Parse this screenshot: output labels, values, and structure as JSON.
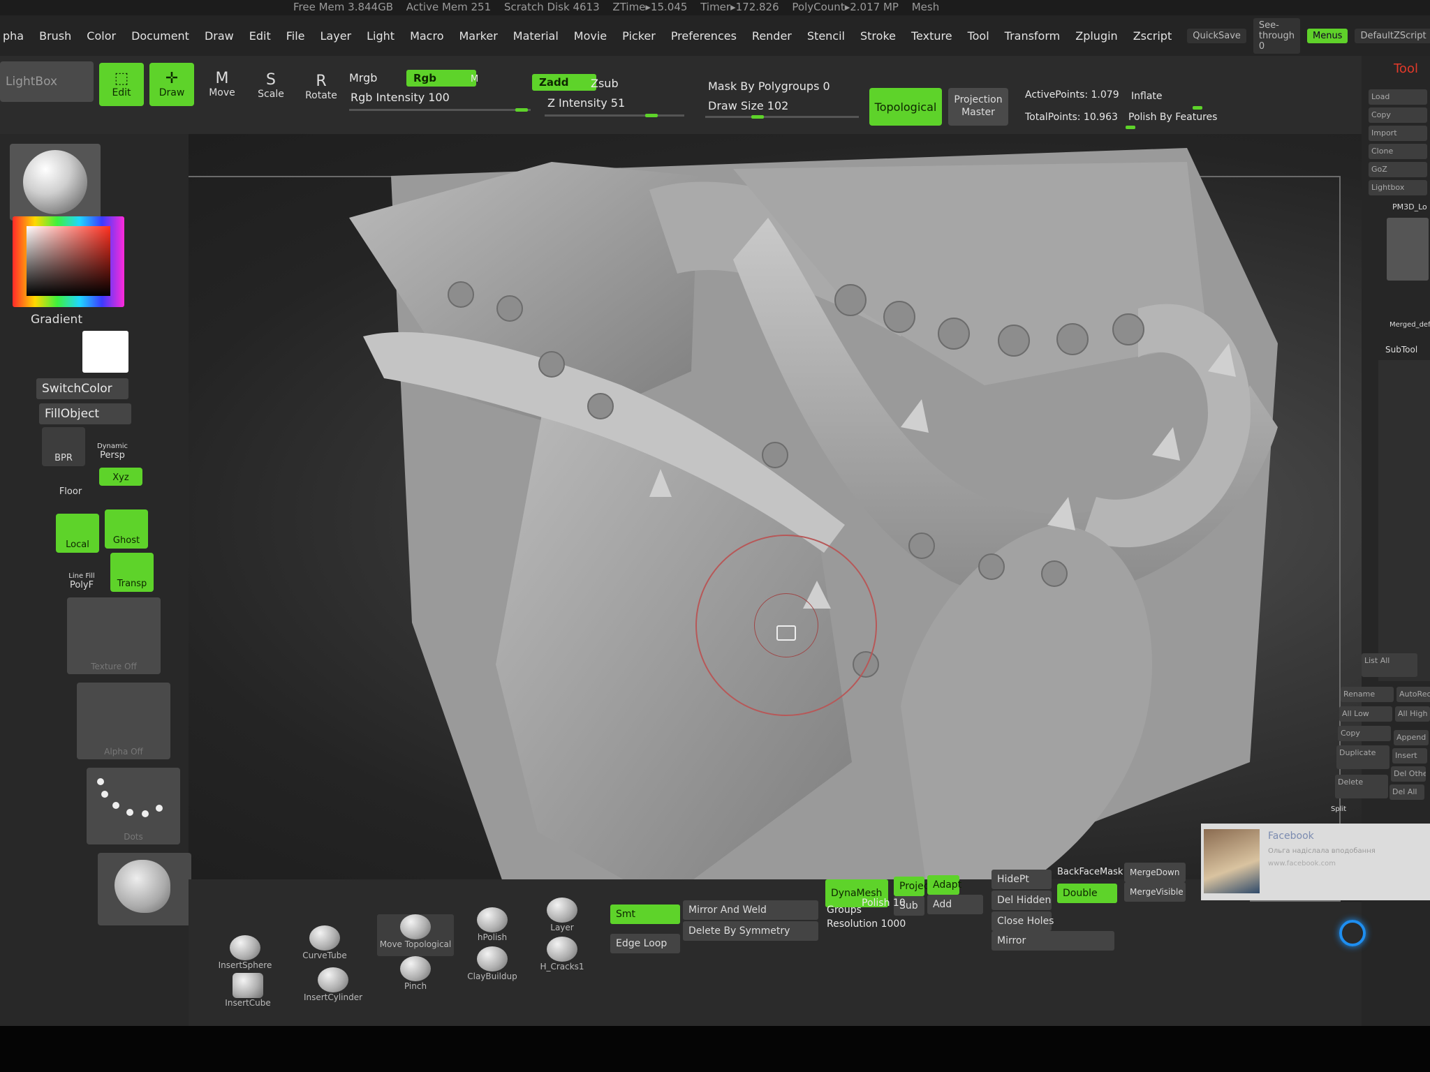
{
  "status": {
    "title": "pha",
    "free_mem": "Free Mem 3.844GB",
    "active_mem": "Active Mem 251",
    "scratch": "Scratch Disk 4613",
    "ztime": "ZTime▸15.045",
    "timer": "Timer▸172.826",
    "polycount": "PolyCount▸2.017 MP",
    "mesh": "Mesh"
  },
  "menu": {
    "items": [
      "Brush",
      "Color",
      "Document",
      "Draw",
      "Edit",
      "File",
      "Layer",
      "Light",
      "Macro",
      "Marker",
      "Material",
      "Movie",
      "Picker",
      "Preferences",
      "Render",
      "Stencil",
      "Stroke",
      "Texture",
      "Tool",
      "Transform",
      "Zplugin",
      "Zscript"
    ],
    "quicksave": "QuickSave",
    "seethrough": "See-through 0",
    "menus": "Menus",
    "defaultzscript": "DefaultZScript"
  },
  "toolbar": {
    "lightbox": "LightBox",
    "edit": "Edit",
    "draw": "Draw",
    "move": "Move",
    "scale": "Scale",
    "rotate": "Rotate",
    "mrgb": "Mrgb",
    "rgb": "Rgb",
    "m": "M",
    "rgb_intensity": "Rgb Intensity 100",
    "zadd": "Zadd",
    "zsub": "Zsub",
    "z_intensity": "Z Intensity 51",
    "mask_polygroups": "Mask By Polygroups 0",
    "draw_size": "Draw Size 102",
    "topological": "Topological",
    "projection_master": "Projection Master",
    "active_points": "ActivePoints: 1.079",
    "total_points": "TotalPoints: 10.963",
    "inflate": "Inflate",
    "polish_features": "Polish By Features"
  },
  "left": {
    "gradient": "Gradient",
    "switchcolor": "SwitchColor",
    "fillobject": "FillObject",
    "bpr": "BPR",
    "dynamic": "Dynamic",
    "persp": "Persp",
    "floor": "Floor",
    "xyz": "Xyz",
    "local": "Local",
    "ghost": "Ghost",
    "line_fill": "Line Fill",
    "polyf": "PolyF",
    "transp": "Transp",
    "texture_off": "Texture Off",
    "alpha_off": "Alpha Off",
    "dots": "Dots"
  },
  "bottom": {
    "brushes": [
      "InsertSphere",
      "CurveTube",
      "Move Topological",
      "hPolish",
      "Layer",
      "InsertCube",
      "InsertCylinder",
      "Pinch",
      "ClayBuildup",
      "H_Cracks1"
    ],
    "smt": "Smt",
    "edge_loop": "Edge Loop",
    "mirror_weld": "Mirror And Weld",
    "delete_symmetry": "Delete By Symmetry",
    "dynamesh": "DynaMesh",
    "project": "Projec",
    "adapt": "Adapt",
    "sub": "Sub",
    "add": "Add",
    "groups": "Groups",
    "polish": "Polish 10",
    "resolution": "Resolution 1000",
    "hidept": "HidePt",
    "del_hidden": "Del Hidden",
    "close_holes": "Close Holes",
    "mirror": "Mirror",
    "backfacemask": "BackFaceMask",
    "double": "Double",
    "mergedown": "MergeDown",
    "mergevisible": "MergeVisible"
  },
  "right": {
    "tool": "Tool",
    "buttons": [
      "Load",
      "Copy",
      "Import",
      "Clone",
      "GoZ",
      "Lightbox",
      "PM3D_Lo"
    ],
    "merged": "Merged_defau",
    "subtool": "SubTool",
    "list_all": "List All",
    "sub_buttons": [
      "Rename",
      "All Low",
      "Copy",
      "Duplicate",
      "Delete",
      "AutoReo",
      "All High",
      "Append",
      "Insert",
      "Del Other",
      "Del All"
    ],
    "split": "Split"
  },
  "facebook": {
    "title": "Facebook",
    "line1": "Ольга надіслала вподобання",
    "line2": "www.facebook.com"
  },
  "colors": {
    "accent": "#5ed32a",
    "brush_ring": "#b75858",
    "led": "#1e8ef0"
  }
}
